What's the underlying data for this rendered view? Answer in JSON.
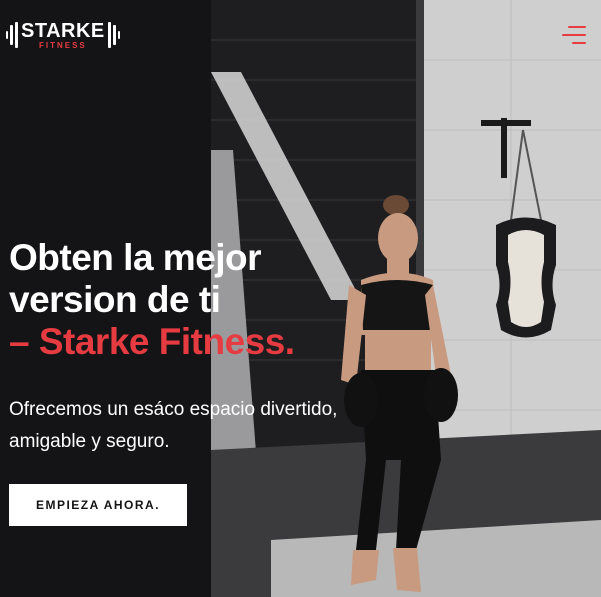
{
  "header": {
    "logo": {
      "brand": "STARKE",
      "sub": "FITNESS"
    },
    "menu_icon": "hamburger-menu-icon"
  },
  "hero": {
    "headline": {
      "line1": "Obten la mejor",
      "line2": "version de ti",
      "accent": "– Starke Fitness."
    },
    "description": {
      "line1": "Ofrecemos un esáco espacio divertido,",
      "line2": "amigable y seguro."
    },
    "cta_label": "EMPIEZA AHORA."
  },
  "colors": {
    "accent": "#e63c41",
    "background": "#141416",
    "text": "#ffffff"
  }
}
